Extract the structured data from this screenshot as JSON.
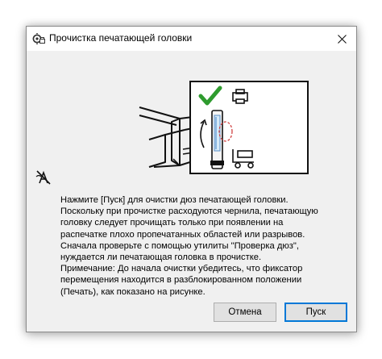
{
  "window": {
    "title": "Прочистка печатающей головки",
    "close_icon": "close-icon",
    "title_icon": "printer-settings-icon"
  },
  "content": {
    "illustration_icon": "printhead-cleaning-illustration",
    "side_icon": "nozzle-cleaning-icon",
    "message": "Нажмите [Пуск] для очистки дюз печатающей головки.\nПоскольку при прочистке расходуются чернила, печатающую головку следует прочищать только при появлении на распечатке плохо пропечатанных областей или разрывов.\nСначала проверьте с помощью утилиты \"Проверка дюз\", нуждается ли печатающая головка в прочистке.\nПримечание: До начала очистки убедитесь, что фиксатор перемещения находится в разблокированном положении (Печать), как показано на рисунке."
  },
  "buttons": {
    "cancel_label": "Отмена",
    "start_label": "Пуск"
  },
  "colors": {
    "accent": "#0078d7",
    "check_green": "#2e9b2e",
    "dialog_bg": "#f0f0f0"
  }
}
